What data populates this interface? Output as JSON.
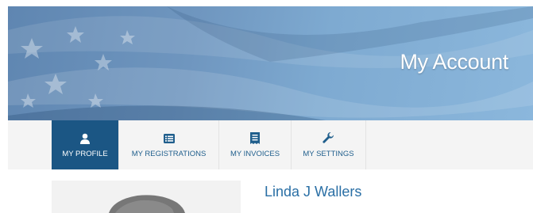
{
  "header": {
    "title": "My Account"
  },
  "nav": {
    "tabs": [
      {
        "label": "MY PROFILE",
        "icon": "user-icon",
        "active": true
      },
      {
        "label": "MY REGISTRATIONS",
        "icon": "list-icon",
        "active": false
      },
      {
        "label": "MY INVOICES",
        "icon": "invoice-icon",
        "active": false
      },
      {
        "label": "MY SETTINGS",
        "icon": "wrench-icon",
        "active": false
      }
    ]
  },
  "profile": {
    "name": "Linda J Wallers"
  },
  "colors": {
    "active_tab": "#1b5684",
    "accent_text": "#2a6fa5",
    "nav_bg": "#f4f4f4"
  }
}
